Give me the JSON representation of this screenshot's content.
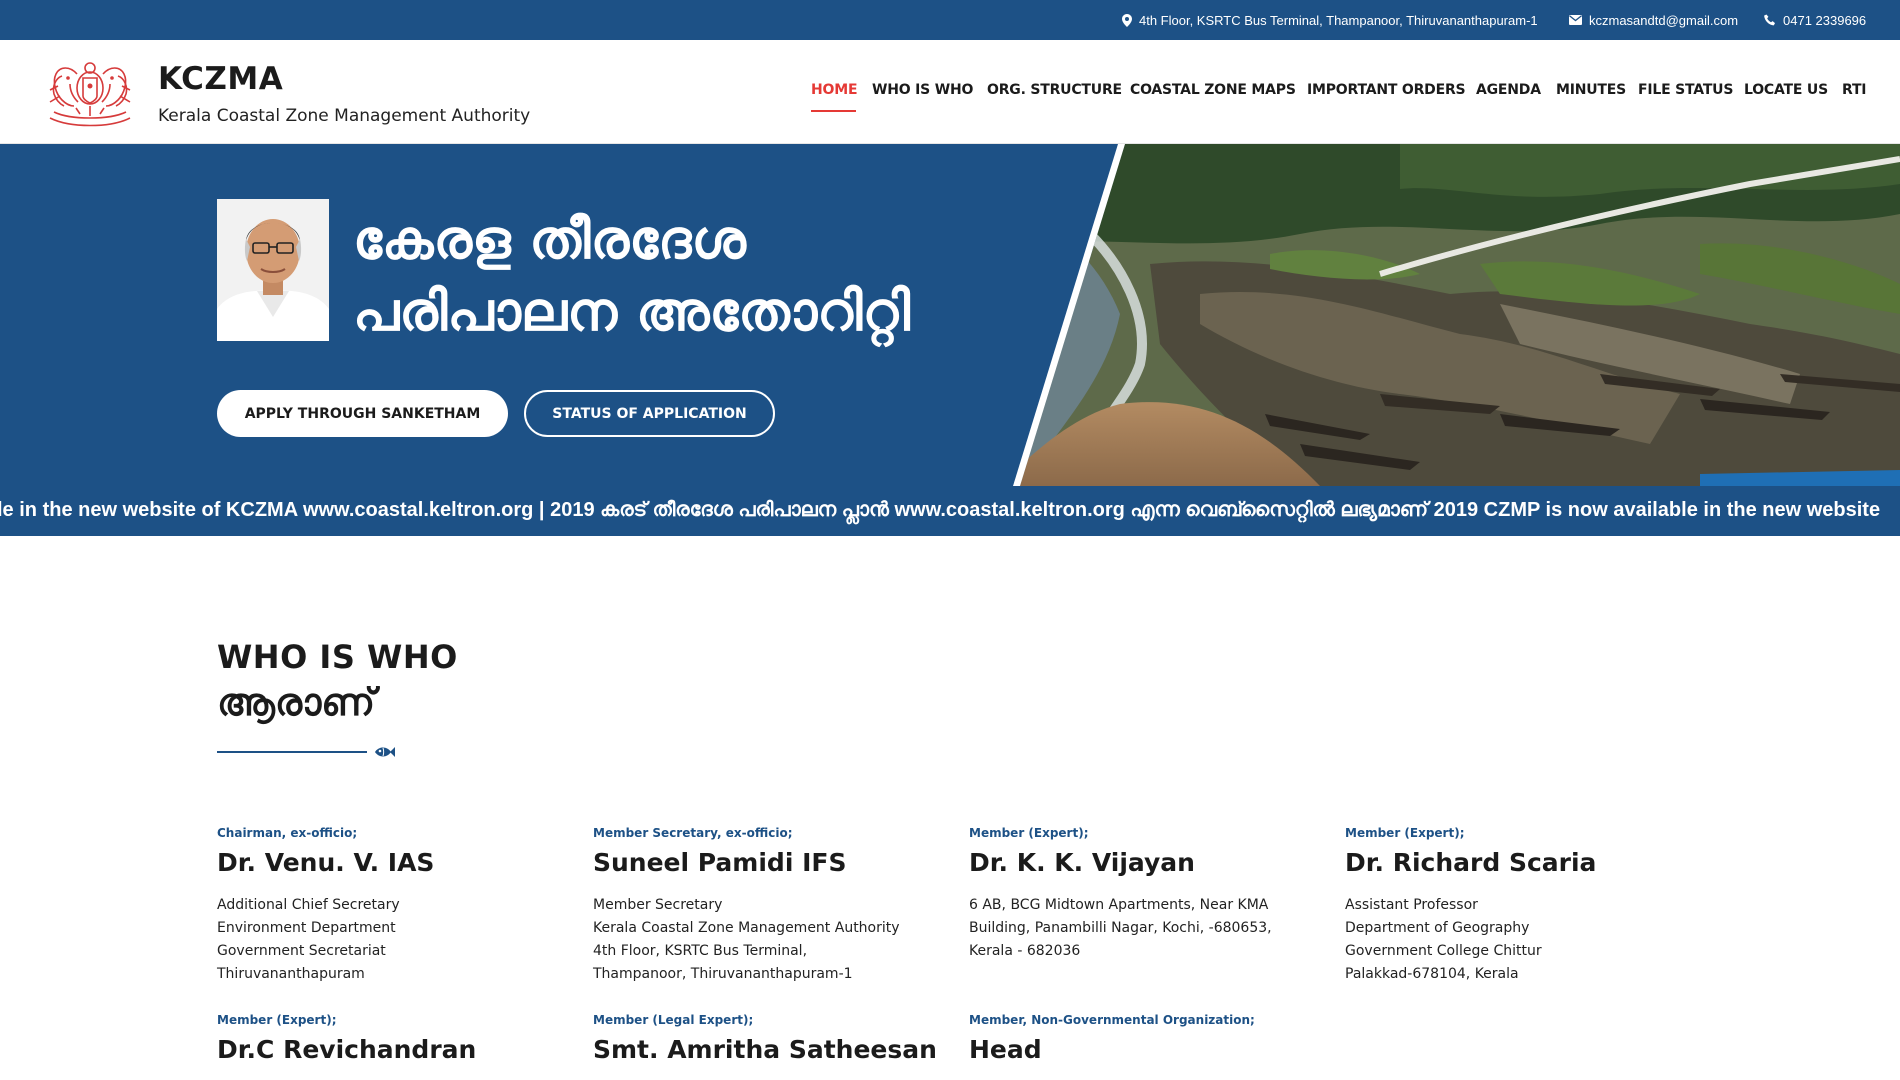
{
  "topbar": {
    "address": "4th Floor, KSRTC Bus Terminal, Thampanoor, Thiruvananthapuram-1",
    "email": "kczmasandtd@gmail.com",
    "phone": "0471 2339696"
  },
  "brand": {
    "title": "KCZMA",
    "subtitle": "Kerala Coastal Zone Management Authority"
  },
  "nav": {
    "items": [
      "HOME",
      "WHO IS WHO",
      "ORG. STRUCTURE",
      "COASTAL ZONE MAPS",
      "IMPORTANT ORDERS",
      "AGENDA",
      "MINUTES",
      "FILE STATUS",
      "LOCATE US",
      "RTI"
    ],
    "active": "HOME"
  },
  "hero": {
    "title_line1": "കേരള തീരദേശ",
    "title_line2": "പരിപാലന അതോറിറ്റി",
    "apply_button": "APPLY THROUGH SANKETHAM",
    "status_button": "STATUS OF APPLICATION"
  },
  "ticker": {
    "text": "le in the new website of KCZMA www.coastal.keltron.org | 2019 കരട് തീരദേശ പരിപാലന പ്ലാൻ www.coastal.keltron.org എന്ന വെബ്സൈറ്റിൽ ലഭ്യമാണ് 2019 CZMP is now available in the new website"
  },
  "section": {
    "title": "WHO IS WHO",
    "subtitle": "ആരാണ്"
  },
  "members": [
    {
      "role": "Chairman, ex-officio;",
      "name": "Dr. Venu. V. IAS",
      "address": [
        "Additional Chief Secretary",
        "Environment Department",
        "Government Secretariat",
        "Thiruvananthapuram"
      ]
    },
    {
      "role": "Member Secretary, ex-officio;",
      "name": "Suneel Pamidi IFS",
      "address": [
        "Member Secretary",
        "Kerala Coastal Zone Management Authority",
        "4th Floor, KSRTC Bus Terminal,",
        "Thampanoor, Thiruvananthapuram-1"
      ]
    },
    {
      "role": "Member (Expert);",
      "name": "Dr. K. K. Vijayan",
      "address": [
        "6 AB, BCG Midtown Apartments, Near KMA",
        "Building, Panambilli Nagar, Kochi, -680653,",
        "Kerala - 682036"
      ]
    },
    {
      "role": "Member (Expert);",
      "name": "Dr. Richard Scaria",
      "address": [
        "Assistant Professor",
        "Department of Geography",
        "Government College Chittur",
        "Palakkad-678104, Kerala"
      ]
    },
    {
      "role": "Member (Expert);",
      "name": "Dr.C Revichandran",
      "address": []
    },
    {
      "role": "Member (Legal Expert);",
      "name": "Smt. Amritha Satheesan",
      "address": []
    },
    {
      "role": "Member, Non-Governmental Organization;",
      "name": "Head",
      "address": []
    }
  ],
  "colors": {
    "primary": "#1d5186",
    "accent": "#e53935"
  }
}
